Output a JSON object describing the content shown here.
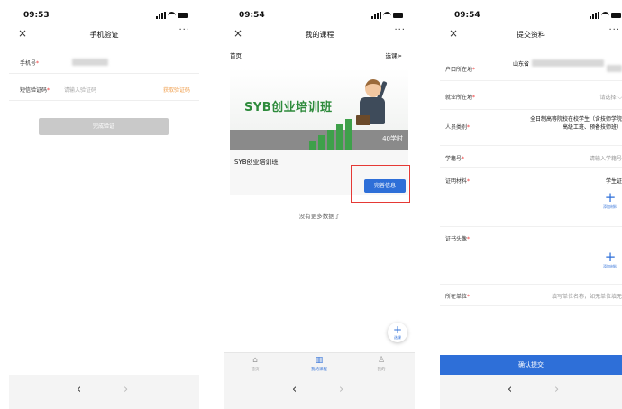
{
  "screen1": {
    "time": "09:53",
    "title": "手机验证",
    "phone_label": "手机号",
    "sms_label": "短信验证码",
    "sms_placeholder": "请输入验证码",
    "get_code": "获取验证码",
    "submit": "完成验证"
  },
  "screen2": {
    "time": "09:54",
    "title": "我的课程",
    "breadcrumb": "首页",
    "select_course": "选课>",
    "banner_text": "SYB创业培训班",
    "hours": "40学时",
    "course_name": "SYB创业培训班",
    "complete_info": "完善信息",
    "no_more": "没有更多数据了",
    "fab_label": "选课",
    "tabs": [
      {
        "label": "首页",
        "icon": "home-icon"
      },
      {
        "label": "我的课程",
        "icon": "book-icon"
      },
      {
        "label": "我的",
        "icon": "person-icon"
      }
    ]
  },
  "screen3": {
    "time": "09:54",
    "title": "提交资料",
    "hukou_label": "户口所在地",
    "hukou_prefix": "山东省",
    "job_label": "就业所在地",
    "job_value": "请选择",
    "category_label": "人员类别",
    "category_value_line1": "全日制高等院校在校学生（含技师学院",
    "category_value_line2": "高级工班、预备技师班）",
    "student_id_label": "学籍号",
    "student_id_placeholder": "请输入学籍号",
    "proof_label": "证明材料",
    "proof_value": "学生证",
    "add_material": "添加材料",
    "photo_label": "证书头像",
    "org_label": "所在单位",
    "org_placeholder": "填写单位名称，如无单位填无",
    "confirm": "确认提交"
  },
  "common": {
    "close": "×",
    "more": "···",
    "back": "‹",
    "forward": "›",
    "required": "*"
  }
}
